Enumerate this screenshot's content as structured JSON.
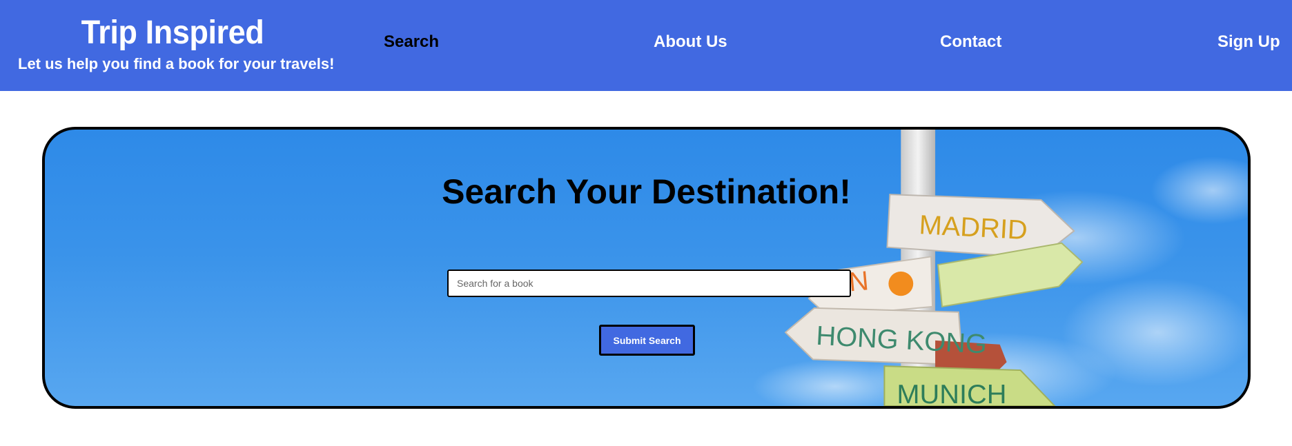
{
  "header": {
    "title": "Trip Inspired",
    "tagline": "Let us help you find a book for your travels!",
    "background_color": "#4169e1"
  },
  "nav": {
    "items": [
      {
        "label": "Search",
        "active": true
      },
      {
        "label": "About Us",
        "active": false
      },
      {
        "label": "Contact",
        "active": false
      },
      {
        "label": "Sign Up",
        "active": false
      }
    ]
  },
  "hero": {
    "title": "Search Your Destination!",
    "background": "signpost-sky-photo",
    "signs": [
      "MADRID",
      "SUN",
      "HONG KONG",
      "MUNICH"
    ],
    "search": {
      "value": "",
      "placeholder": "Search for a book"
    },
    "submit_label": "Submit Search",
    "button_color": "#4169e1"
  }
}
